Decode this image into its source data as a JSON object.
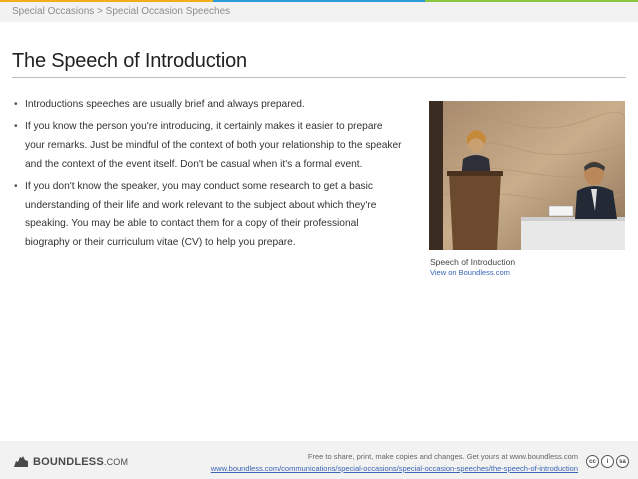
{
  "breadcrumb": "Special Occasions > Special Occasion Speeches",
  "title": "The Speech of Introduction",
  "bullets": [
    "Introductions speeches are usually brief and always prepared.",
    "If you know the person you're introducing, it certainly makes it easier to prepare your remarks. Just be mindful of the context of both your relationship to the speaker and the context of the event itself. Don't be casual when it's a formal event.",
    "If you don't know the speaker, you may conduct some research to get a basic understanding of their life and work relevant to the subject about which they're speaking. You may be able to contact them for a copy of their professional biography or their curriculum vitae (CV) to help you prepare."
  ],
  "figure": {
    "caption": "Speech of Introduction",
    "link": "View on Boundless.com"
  },
  "footer": {
    "logo_word": "BOUNDLESS",
    "logo_suffix": ".COM",
    "free_text": "Free to share, print, make copies and changes. Get yours at www.boundless.com",
    "url": "www.boundless.com/communications/special-occasions/special-occasion-speeches/the-speech-of-introduction",
    "license": [
      "cc",
      "i",
      "sa"
    ]
  },
  "colors": {
    "strip": [
      "#f0ad1c",
      "#8cc63f",
      "#2d9ad8",
      "#f0ad1c",
      "#8cc63f",
      "#2d9ad8"
    ],
    "link": "#3a64b5"
  }
}
